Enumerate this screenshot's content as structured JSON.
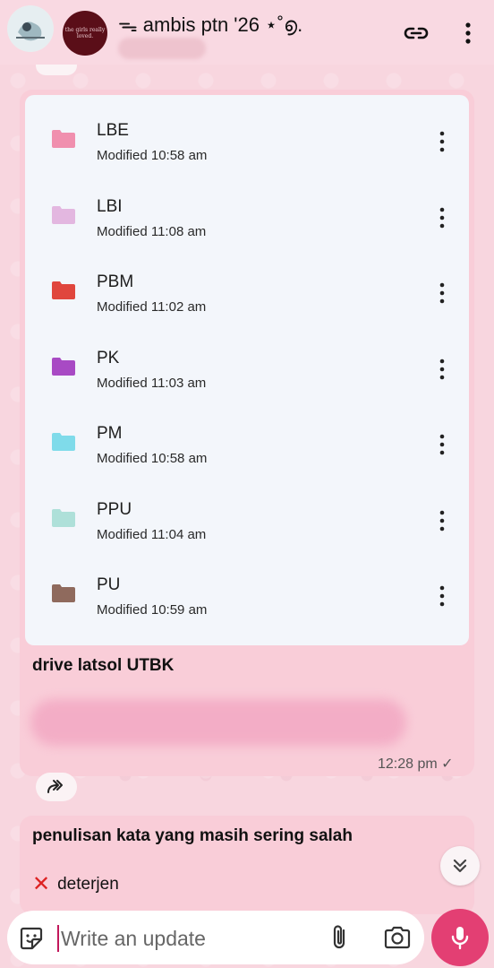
{
  "header": {
    "title": "ᯓ ambis ptn '26 ⋆˚൭.",
    "avatar_text": "the girls really loved."
  },
  "drive": {
    "files": [
      {
        "name": "LBE",
        "modified": "Modified 10:58 am",
        "color": "#f08fae"
      },
      {
        "name": "LBI",
        "modified": "Modified 11:08 am",
        "color": "#e3b7e0"
      },
      {
        "name": "PBM",
        "modified": "Modified 11:02 am",
        "color": "#e0463d"
      },
      {
        "name": "PK",
        "modified": "Modified 11:03 am",
        "color": "#a84ac4"
      },
      {
        "name": "PM",
        "modified": "Modified 10:58 am",
        "color": "#7fdbea"
      },
      {
        "name": "PPU",
        "modified": "Modified 11:04 am",
        "color": "#aee0d9"
      },
      {
        "name": "PU",
        "modified": "Modified 10:59 am",
        "color": "#8f6a5d"
      }
    ]
  },
  "message1": {
    "caption": "drive latsol UTBK",
    "time": "12:28 pm ✓"
  },
  "message2": {
    "title": "penulisan kata yang masih sering salah",
    "line1": "deterjen"
  },
  "composer": {
    "placeholder": "Write an update"
  },
  "colors": {
    "background": "#f8d6df",
    "bubble": "#f9cdd8",
    "mic": "#e33f73"
  }
}
